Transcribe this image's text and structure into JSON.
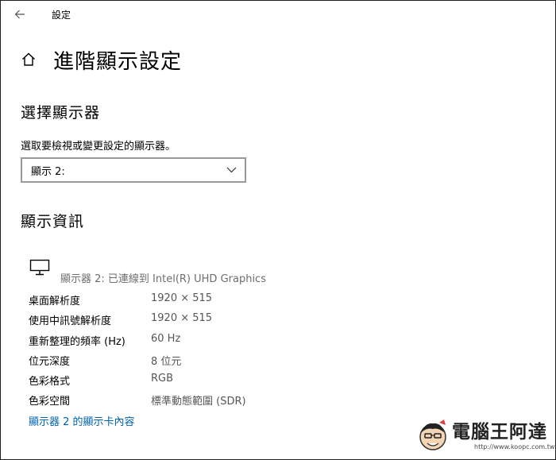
{
  "window": {
    "title": "設定",
    "back_icon": "back-arrow-icon"
  },
  "header": {
    "home_icon": "home-icon",
    "page_title": "進階顯示設定"
  },
  "select_display": {
    "section_title": "選擇顯示器",
    "description": "選取要檢視或變更設定的顯示器。",
    "dropdown_value": "顯示 2:"
  },
  "display_info": {
    "section_title": "顯示資訊",
    "monitor_icon": "monitor-icon",
    "monitor_label": "顯示器 2: 已連線到 Intel(R) UHD Graphics",
    "rows": [
      {
        "key": "桌面解析度",
        "value": "1920 × 515"
      },
      {
        "key": "使用中訊號解析度",
        "value": "1920 × 515"
      },
      {
        "key": "重新整理的頻率 (Hz)",
        "value": "60 Hz"
      },
      {
        "key": "位元深度",
        "value": "8 位元"
      },
      {
        "key": "色彩格式",
        "value": "RGB"
      },
      {
        "key": "色彩空間",
        "value": "標準動態範圍 (SDR)"
      }
    ],
    "adapter_link": "顯示器 2 的顯示卡內容"
  },
  "watermark": {
    "title": "電腦王阿達",
    "url": "http://www.koopc.com.tw"
  },
  "colors": {
    "link": "#0063b1",
    "value_text": "#555555",
    "border": "#999999"
  }
}
